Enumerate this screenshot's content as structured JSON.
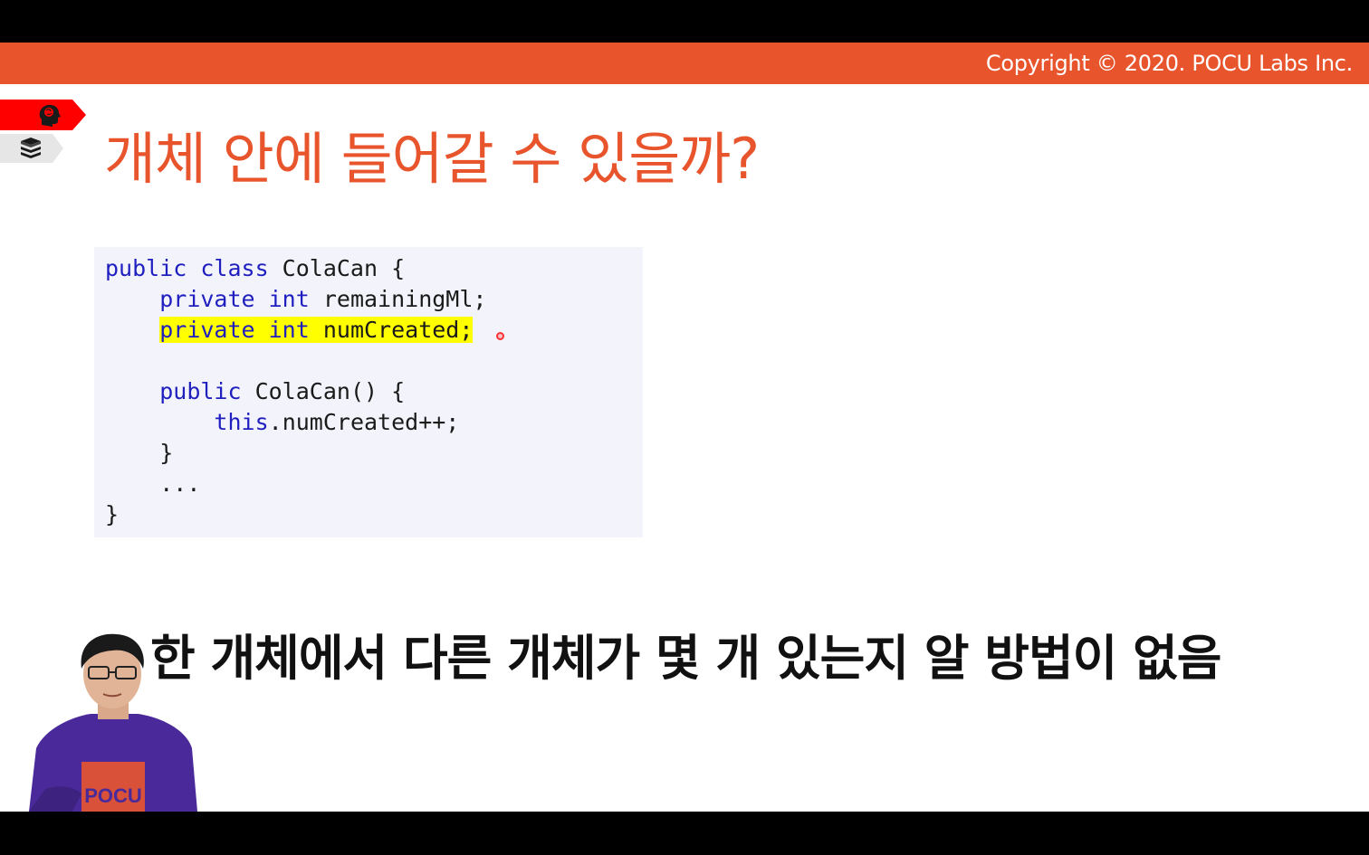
{
  "header": {
    "copyright": "Copyright © 2020. POCU Labs Inc.",
    "accent_color": "#e8552d"
  },
  "side_tags": {
    "icons": [
      "brain-icon",
      "book-stack-icon"
    ]
  },
  "slide": {
    "title": "개체 안에 들어갈 수 있을까?"
  },
  "code": {
    "lines": [
      {
        "indent": "",
        "kw": "public class",
        "rest": " ColaCan {"
      },
      {
        "indent": "    ",
        "kw": "private int",
        "rest": " remainingMl;"
      },
      {
        "indent": "    ",
        "kw": "private int",
        "rest": " numCreated;",
        "highlight": true
      },
      {
        "indent": "",
        "kw": "",
        "rest": ""
      },
      {
        "indent": "    ",
        "kw": "public",
        "rest": " ColaCan() {"
      },
      {
        "indent": "        ",
        "kw": "this",
        "rest": ".numCreated++;"
      },
      {
        "indent": "    ",
        "kw": "",
        "rest": "}"
      },
      {
        "indent": "    ",
        "kw": "",
        "rest": "..."
      },
      {
        "indent": "",
        "kw": "",
        "rest": "}"
      }
    ],
    "keyword_color": "#1f1fbf",
    "highlight_color": "#ffff00"
  },
  "caption": {
    "text": "한 개체에서 다른 개체가 몇 개 있는지 알 방법이 없음"
  },
  "presenter": {
    "shirt_text": "POCU"
  }
}
